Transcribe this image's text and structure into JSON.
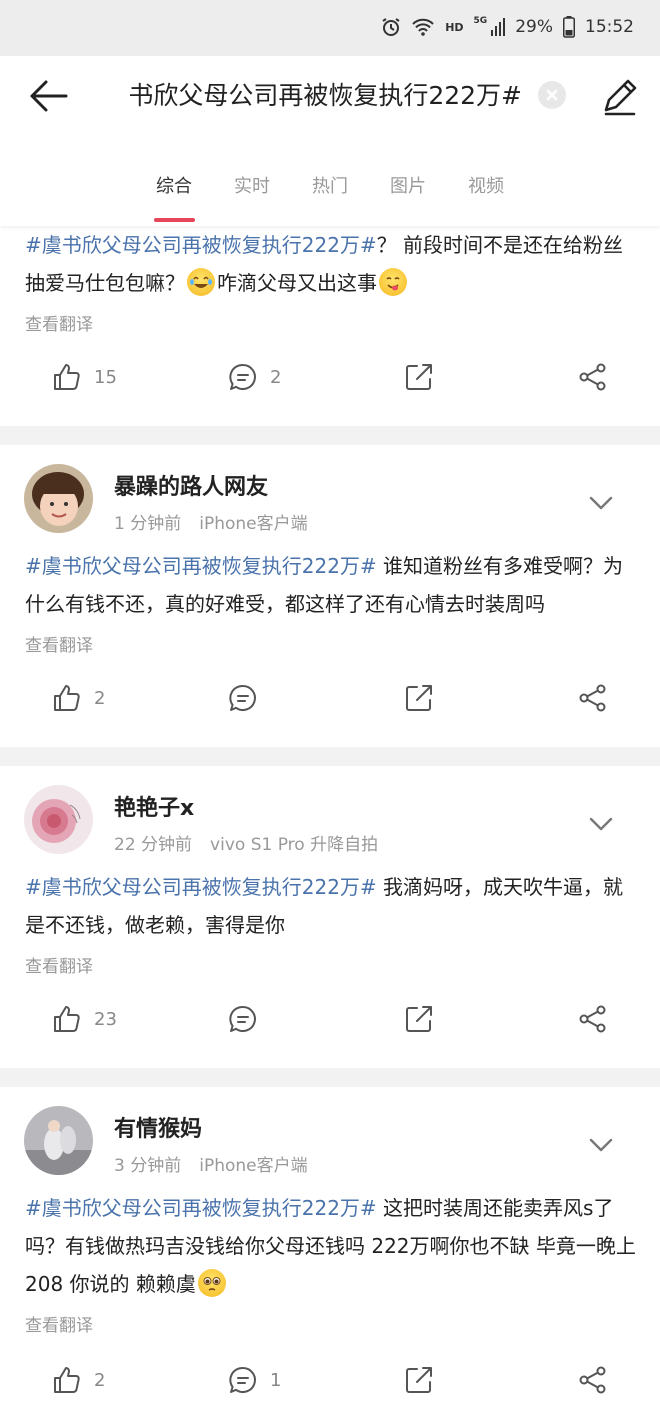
{
  "status_bar": {
    "network": "HD",
    "signal": "5G",
    "battery": "29%",
    "time": "15:52"
  },
  "search": {
    "query": "#虞书欣父母公司再被恢复执行222万#"
  },
  "tabs": [
    "综合",
    "实时",
    "热门",
    "图片",
    "视频"
  ],
  "posts": [
    {
      "hashtag": "#虞书欣父母公司再被恢复执行222万#",
      "text_1": "？ 前段时间不是还在给粉丝抽爱马仕包包嘛？",
      "text_2": "咋滴父母又出这事",
      "translate": "查看翻译",
      "likes": "15",
      "comments": "2"
    },
    {
      "username": "暴躁的路人网友",
      "time": "1 分钟前",
      "source": "iPhone客户端",
      "hashtag": "#虞书欣父母公司再被恢复执行222万#",
      "text": " 谁知道粉丝有多难受啊？为什么有钱不还，真的好难受，都这样了还有心情去时装周吗",
      "translate": "查看翻译",
      "likes": "2",
      "comments": ""
    },
    {
      "username": "艳艳子x",
      "time": "22 分钟前",
      "source": "vivo S1 Pro 升降自拍",
      "hashtag": "#虞书欣父母公司再被恢复执行222万#",
      "text": " 我滴妈呀，成天吹牛逼，就是不还钱，做老赖，害得是你",
      "translate": "查看翻译",
      "likes": "23",
      "comments": ""
    },
    {
      "username": "有情猴妈",
      "time": "3 分钟前",
      "source": "iPhone客户端",
      "hashtag": "#虞书欣父母公司再被恢复执行222万#",
      "text": " 这把时装周还能卖弄风s了吗？有钱做热玛吉没钱给你父母还钱吗 222万啊你也不缺 毕竟一晚上208 你说的 赖赖虞",
      "translate": "查看翻译",
      "likes": "2",
      "comments": "1"
    }
  ],
  "colors": {
    "hashtag": "#4a73ab",
    "tab_indicator": "#e6455c",
    "muted": "#999999"
  },
  "icons": [
    "back-arrow-icon",
    "clear-icon",
    "edit-pencil-icon",
    "like-icon",
    "comment-icon",
    "repost-icon",
    "share-icon",
    "chevron-down-icon"
  ]
}
